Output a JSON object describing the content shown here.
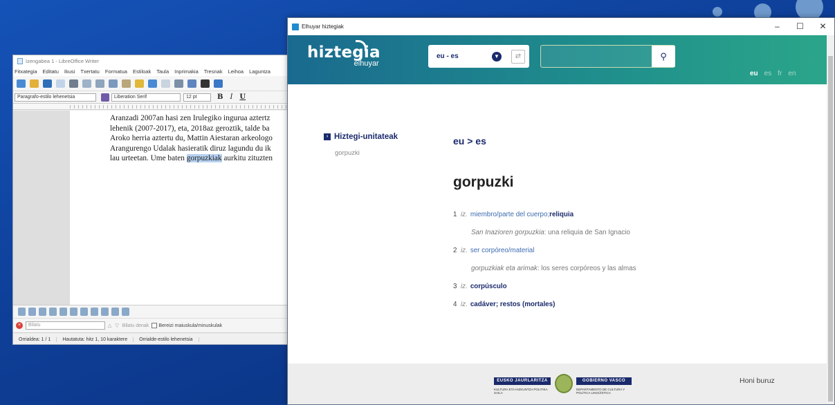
{
  "writer": {
    "title": "Izengabea 1 - LibreOffice Writer",
    "menu": [
      "Fitxategia",
      "Editatu",
      "Ikusi",
      "Txertatu",
      "Formatua",
      "Estiloak",
      "Taula",
      "Inprimakia",
      "Tresnak",
      "Leihoa",
      "Laguntza"
    ],
    "para_style": "Paragrafo-estilo lehenetsia",
    "font_name": "Liberation Serif",
    "font_size": "12 pt",
    "bold": "B",
    "italic": "I",
    "underline": "U",
    "doc_lines": [
      "Aranzadi 2007an hasi zen Irulegiko ingurua aztertz",
      "lehenik (2007-2017), eta, 2018az geroztik, talde ba",
      "Aroko herria aztertu du, Mattin Aiestaran arkeologo",
      "Arangurengo Udalak hasieratik diruz lagundu du ik"
    ],
    "line4_before": "lau urteetan. Ume baten ",
    "line4_highlight": "gorpuzkiak",
    "line4_after": " aurkitu zituzten",
    "find_placeholder": "Bilatu",
    "find_all": "Bilatu denak",
    "match_case": "Bereizi maiuskula/minuskulak",
    "status_page": "Orrialdea: 1 / 1",
    "status_selection": "Hautatuta: hitz 1, 10 karaktere",
    "status_style": "Orrialde-estilo lehenetsia"
  },
  "elhuyar": {
    "window_title": "Elhuyar hiztegiak",
    "logo_main": "hiztegia",
    "logo_sub": "elhuyar",
    "lang_pair": "eu - es",
    "search_value": "",
    "ui_langs": [
      "eu",
      "es",
      "fr",
      "en"
    ],
    "sidebar_title": "Hiztegi-unitateak",
    "sidebar_entry": "gorpuzki",
    "direction": "eu > es",
    "headword": "gorpuzki",
    "senses": [
      {
        "num": "1",
        "pos": "iz.",
        "translation": "miembro/parte del cuerpo; ",
        "bold": "reliquia",
        "example_src": "San Inazioren gorpuzkia",
        "example_tr": ": una reliquia de San Ignacio"
      },
      {
        "num": "2",
        "pos": "iz.",
        "translation": "ser corpóreo/material",
        "bold": "",
        "example_src": "gorpuzkiak eta arimak",
        "example_tr": ": los seres corpóreos y las almas"
      },
      {
        "num": "3",
        "pos": "iz.",
        "translation": "",
        "bold": "corpúsculo",
        "example_src": "",
        "example_tr": ""
      },
      {
        "num": "4",
        "pos": "iz.",
        "translation": "",
        "bold": "cadáver; restos (mortales)",
        "example_src": "",
        "example_tr": ""
      }
    ],
    "footer_left": "EUSKO JAURLARITZA",
    "footer_right": "GOBIERNO VASCO",
    "footer_left_sub": "KULTURA ETA HIZKUNTZA POLITIKA SAILA",
    "footer_right_sub": "DEPARTAMENTO DE CULTURA Y POLÍTICA LINGÜÍSTICA",
    "about": "Honi buruz"
  }
}
